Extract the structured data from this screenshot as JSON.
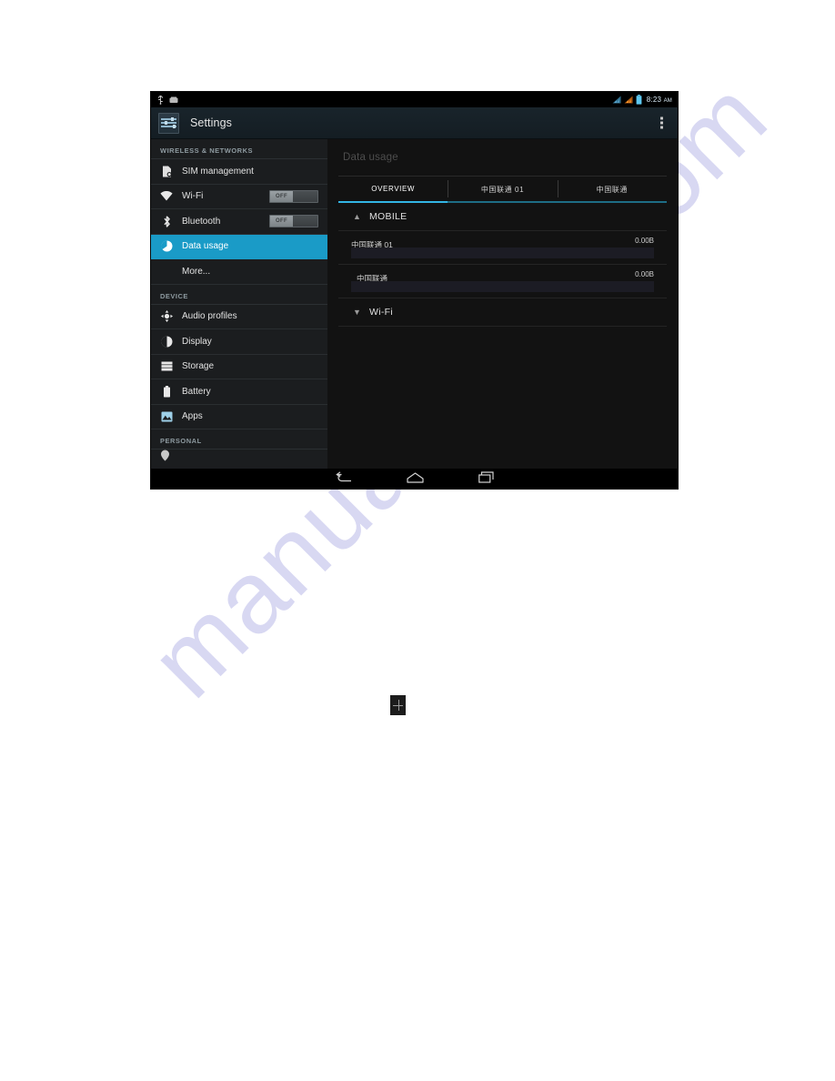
{
  "page": {
    "background_color": "#ffffff",
    "watermark_text": "manualshive.com",
    "watermark_color": "#d8d8f2"
  },
  "device": {
    "status_bar": {
      "time": "8:23",
      "ampm": "AM",
      "left_icons": [
        "usb-debug-icon",
        "sd-card-icon"
      ],
      "right_icons": [
        "signal-sim1-icon",
        "signal-sim2-icon",
        "battery-icon"
      ]
    },
    "action_bar": {
      "app_icon": "settings-sliders-icon",
      "title": "Settings",
      "overflow_icon": "overflow-menu-icon"
    },
    "sidebar": {
      "sections": [
        {
          "header": "WIRELESS & NETWORKS",
          "items": [
            {
              "label": "SIM management",
              "icon": "sim-card-icon",
              "selected": false,
              "toggle": null,
              "indent": false
            },
            {
              "label": "Wi-Fi",
              "icon": "wifi-icon",
              "selected": false,
              "toggle": "OFF",
              "indent": false
            },
            {
              "label": "Bluetooth",
              "icon": "bluetooth-icon",
              "selected": false,
              "toggle": "OFF",
              "indent": false
            },
            {
              "label": "Data usage",
              "icon": "data-usage-icon",
              "selected": true,
              "toggle": null,
              "indent": false
            },
            {
              "label": "More...",
              "icon": null,
              "selected": false,
              "toggle": null,
              "indent": true
            }
          ]
        },
        {
          "header": "DEVICE",
          "items": [
            {
              "label": "Audio profiles",
              "icon": "audio-profiles-icon",
              "selected": false,
              "toggle": null,
              "indent": false
            },
            {
              "label": "Display",
              "icon": "display-icon",
              "selected": false,
              "toggle": null,
              "indent": false
            },
            {
              "label": "Storage",
              "icon": "storage-icon",
              "selected": false,
              "toggle": null,
              "indent": false
            },
            {
              "label": "Battery",
              "icon": "battery-icon",
              "selected": false,
              "toggle": null,
              "indent": false
            },
            {
              "label": "Apps",
              "icon": "apps-icon",
              "selected": false,
              "toggle": null,
              "indent": false
            }
          ]
        },
        {
          "header": "PERSONAL",
          "items": []
        }
      ]
    },
    "main": {
      "title": "Data usage",
      "tabs": [
        {
          "label": "OVERVIEW",
          "active": true
        },
        {
          "label": "中国联通 01",
          "active": false
        },
        {
          "label": "中国联通",
          "active": false
        }
      ],
      "accent_color": "#33b5e5",
      "sections": [
        {
          "label": "MOBILE",
          "expanded": true,
          "chevron": "chevron-up-icon",
          "rows": [
            {
              "name": "中国联通 01",
              "value": "0.00B"
            },
            {
              "name": "中国联通",
              "value": "0.00B"
            }
          ]
        },
        {
          "label": "Wi-Fi",
          "expanded": false,
          "chevron": "chevron-down-icon",
          "rows": []
        }
      ]
    },
    "nav_bar": {
      "buttons": [
        {
          "name": "back-button",
          "icon": "back-arrow-icon"
        },
        {
          "name": "home-button",
          "icon": "home-icon"
        },
        {
          "name": "recents-button",
          "icon": "recents-icon"
        }
      ]
    }
  }
}
